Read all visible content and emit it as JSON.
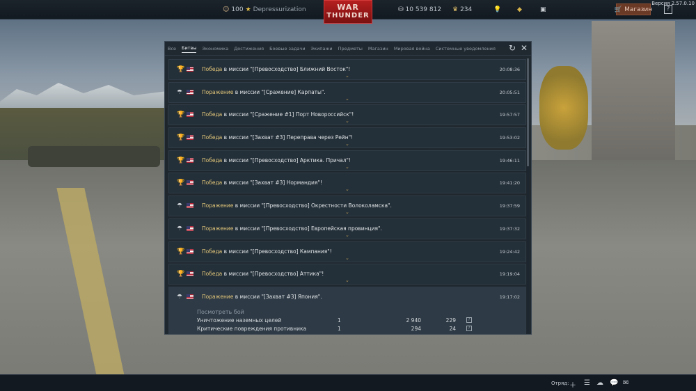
{
  "topbar": {
    "rank": "100",
    "nickname": "Depressurization",
    "logo_line1": "WAR",
    "logo_line2": "THUNDER",
    "silver_lions": "10 539 812",
    "eagles": "234",
    "shop_label": "Магазин",
    "help_label": "?",
    "version": "Версия 2.57.0.10"
  },
  "tabs": [
    {
      "label": "Все",
      "active": false
    },
    {
      "label": "Битвы",
      "active": true
    },
    {
      "label": "Экономика",
      "active": false
    },
    {
      "label": "Достижения",
      "active": false
    },
    {
      "label": "Боевые задачи",
      "active": false
    },
    {
      "label": "Экипажи",
      "active": false
    },
    {
      "label": "Предметы",
      "active": false
    },
    {
      "label": "Магазин",
      "active": false
    },
    {
      "label": "Мировая война",
      "active": false
    },
    {
      "label": "Системные уведомления",
      "active": false
    }
  ],
  "battles": [
    {
      "result": "Победа",
      "text": " в миссии \"[Превосходство] Ближний Восток\"!",
      "time": "20:08:36",
      "icon": "trophy-icon"
    },
    {
      "result": "Поражение",
      "text": " в миссии \"[Сражение] Карпаты\".",
      "time": "20:05:51",
      "icon": "parachute-icon"
    },
    {
      "result": "Победа",
      "text": " в миссии \"[Сражение #1] Порт Новороссийск\"!",
      "time": "19:57:57",
      "icon": "trophy-icon"
    },
    {
      "result": "Победа",
      "text": " в миссии \"[Захват #3] Переправа через Рейн\"!",
      "time": "19:53:02",
      "icon": "trophy-icon"
    },
    {
      "result": "Победа",
      "text": " в миссии \"[Превосходство] Арктика. Причал\"!",
      "time": "19:46:11",
      "icon": "trophy-icon"
    },
    {
      "result": "Победа",
      "text": " в миссии \"[Захват #3] Нормандия\"!",
      "time": "19:41:20",
      "icon": "trophy-icon"
    },
    {
      "result": "Поражение",
      "text": " в миссии \"[Превосходство] Окрестности Волоколамска\".",
      "time": "19:37:59",
      "icon": "parachute-icon"
    },
    {
      "result": "Поражение",
      "text": " в миссии \"[Превосходство] Европейская провинция\".",
      "time": "19:37:32",
      "icon": "parachute-icon"
    },
    {
      "result": "Победа",
      "text": " в миссии \"[Превосходство] Кампания\"!",
      "time": "19:24:42",
      "icon": "trophy-icon"
    },
    {
      "result": "Победа",
      "text": " в миссии \"[Превосходство] Аттика\"!",
      "time": "19:19:04",
      "icon": "trophy-icon"
    }
  ],
  "expanded_battle": {
    "result": "Поражение",
    "text": " в миссии \"[Захват #3] Япония\".",
    "time": "19:17:02",
    "icon": "parachute-icon",
    "view_battle": "Посмотреть бой",
    "details": [
      {
        "name": "Уничтожение наземных целей",
        "count": "1",
        "silver": "2 940",
        "rp": "229",
        "help": "?"
      },
      {
        "name": "Критические повреждения противника",
        "count": "1",
        "silver": "294",
        "rp": "24",
        "help": "?"
      }
    ]
  },
  "bottombar": {
    "squad_label": "Отряд:"
  },
  "colors": {
    "win": "#e3c77a",
    "loss": "#e3c77a",
    "shop": "#6b3a26",
    "logo": "#b51f1f"
  }
}
